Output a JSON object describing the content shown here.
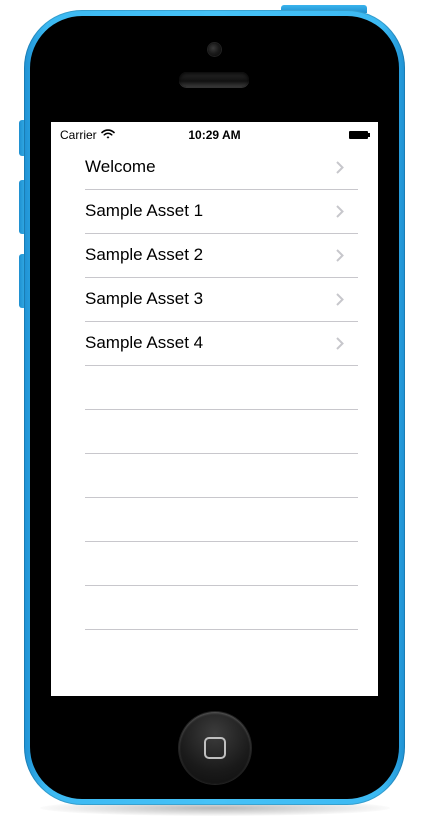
{
  "status_bar": {
    "carrier": "Carrier",
    "time": "10:29 AM",
    "icons": [
      "wifi-icon",
      "battery-icon"
    ]
  },
  "table": {
    "rows": [
      {
        "label": "Welcome",
        "icon": "chevron-right-icon"
      },
      {
        "label": "Sample Asset 1",
        "icon": "chevron-right-icon"
      },
      {
        "label": "Sample Asset 2",
        "icon": "chevron-right-icon"
      },
      {
        "label": "Sample Asset 3",
        "icon": "chevron-right-icon"
      },
      {
        "label": "Sample Asset 4",
        "icon": "chevron-right-icon"
      }
    ],
    "empty_row_count": 6
  },
  "device": {
    "color": "#42bdf5",
    "home_button_icon": "home-square-icon"
  }
}
